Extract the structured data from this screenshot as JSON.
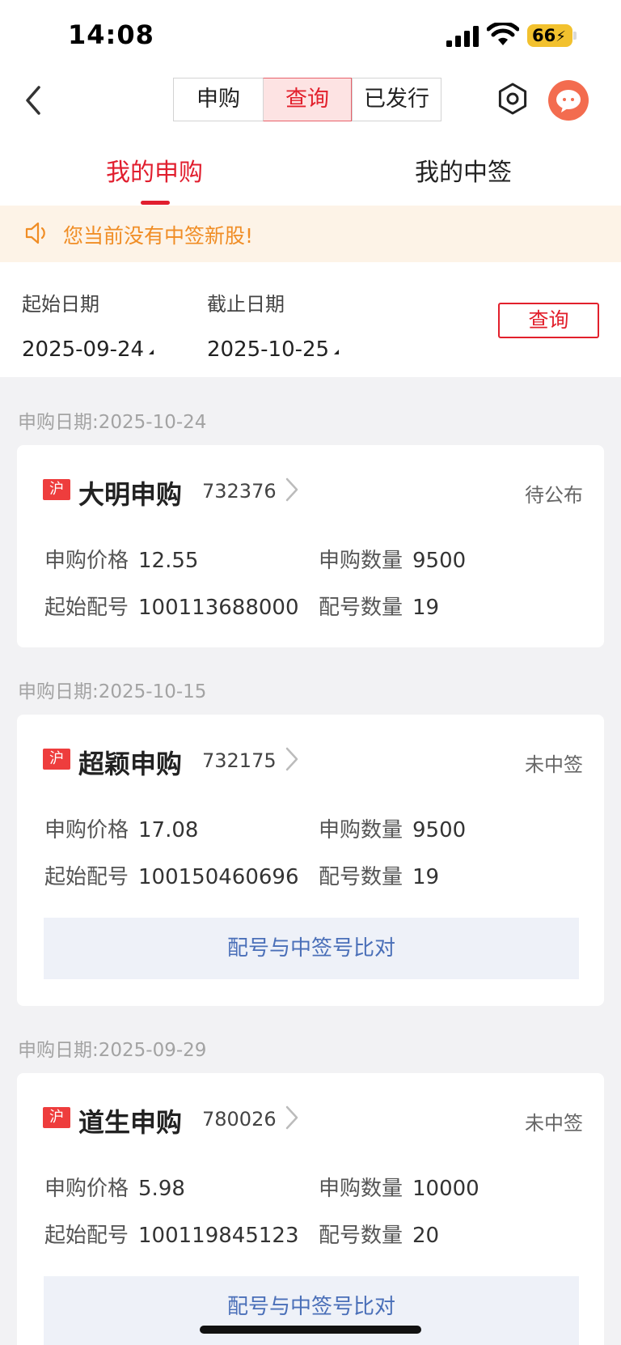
{
  "status_bar": {
    "time": "14:08",
    "battery": "66"
  },
  "navbar": {
    "segments": [
      {
        "label": "申购"
      },
      {
        "label": "查询"
      },
      {
        "label": "已发行"
      }
    ],
    "active_segment": 1
  },
  "tabs": {
    "my_subscriptions": "我的申购",
    "my_winnings": "我的中签"
  },
  "notice": {
    "text": "您当前没有中签新股!"
  },
  "filter": {
    "start_label": "起始日期",
    "start_value": "2025-09-24",
    "end_label": "截止日期",
    "end_value": "2025-10-25",
    "query_button": "查询"
  },
  "labels": {
    "date_prefix": "申购日期:",
    "price": "申购价格",
    "quantity": "申购数量",
    "start_no": "起始配号",
    "no_count": "配号数量",
    "compare_button": "配号与中签号比对"
  },
  "entries": [
    {
      "date": "2025-10-24",
      "market": "沪",
      "name": "大明申购",
      "code": "732376",
      "status": "待公布",
      "price": "12.55",
      "quantity": "9500",
      "start_no": "100113688000",
      "no_count": "19"
    },
    {
      "date": "2025-10-15",
      "market": "沪",
      "name": "超颖申购",
      "code": "732175",
      "status": "未中签",
      "price": "17.08",
      "quantity": "9500",
      "start_no": "100150460696",
      "no_count": "19"
    },
    {
      "date": "2025-09-29",
      "market": "沪",
      "name": "道生申购",
      "code": "780026",
      "status": "未中签",
      "price": "5.98",
      "quantity": "10000",
      "start_no": "100119845123",
      "no_count": "20"
    }
  ],
  "colors": {
    "accent": "#e11e2e",
    "notice": "#f08d25",
    "link": "#4a6fb8"
  }
}
